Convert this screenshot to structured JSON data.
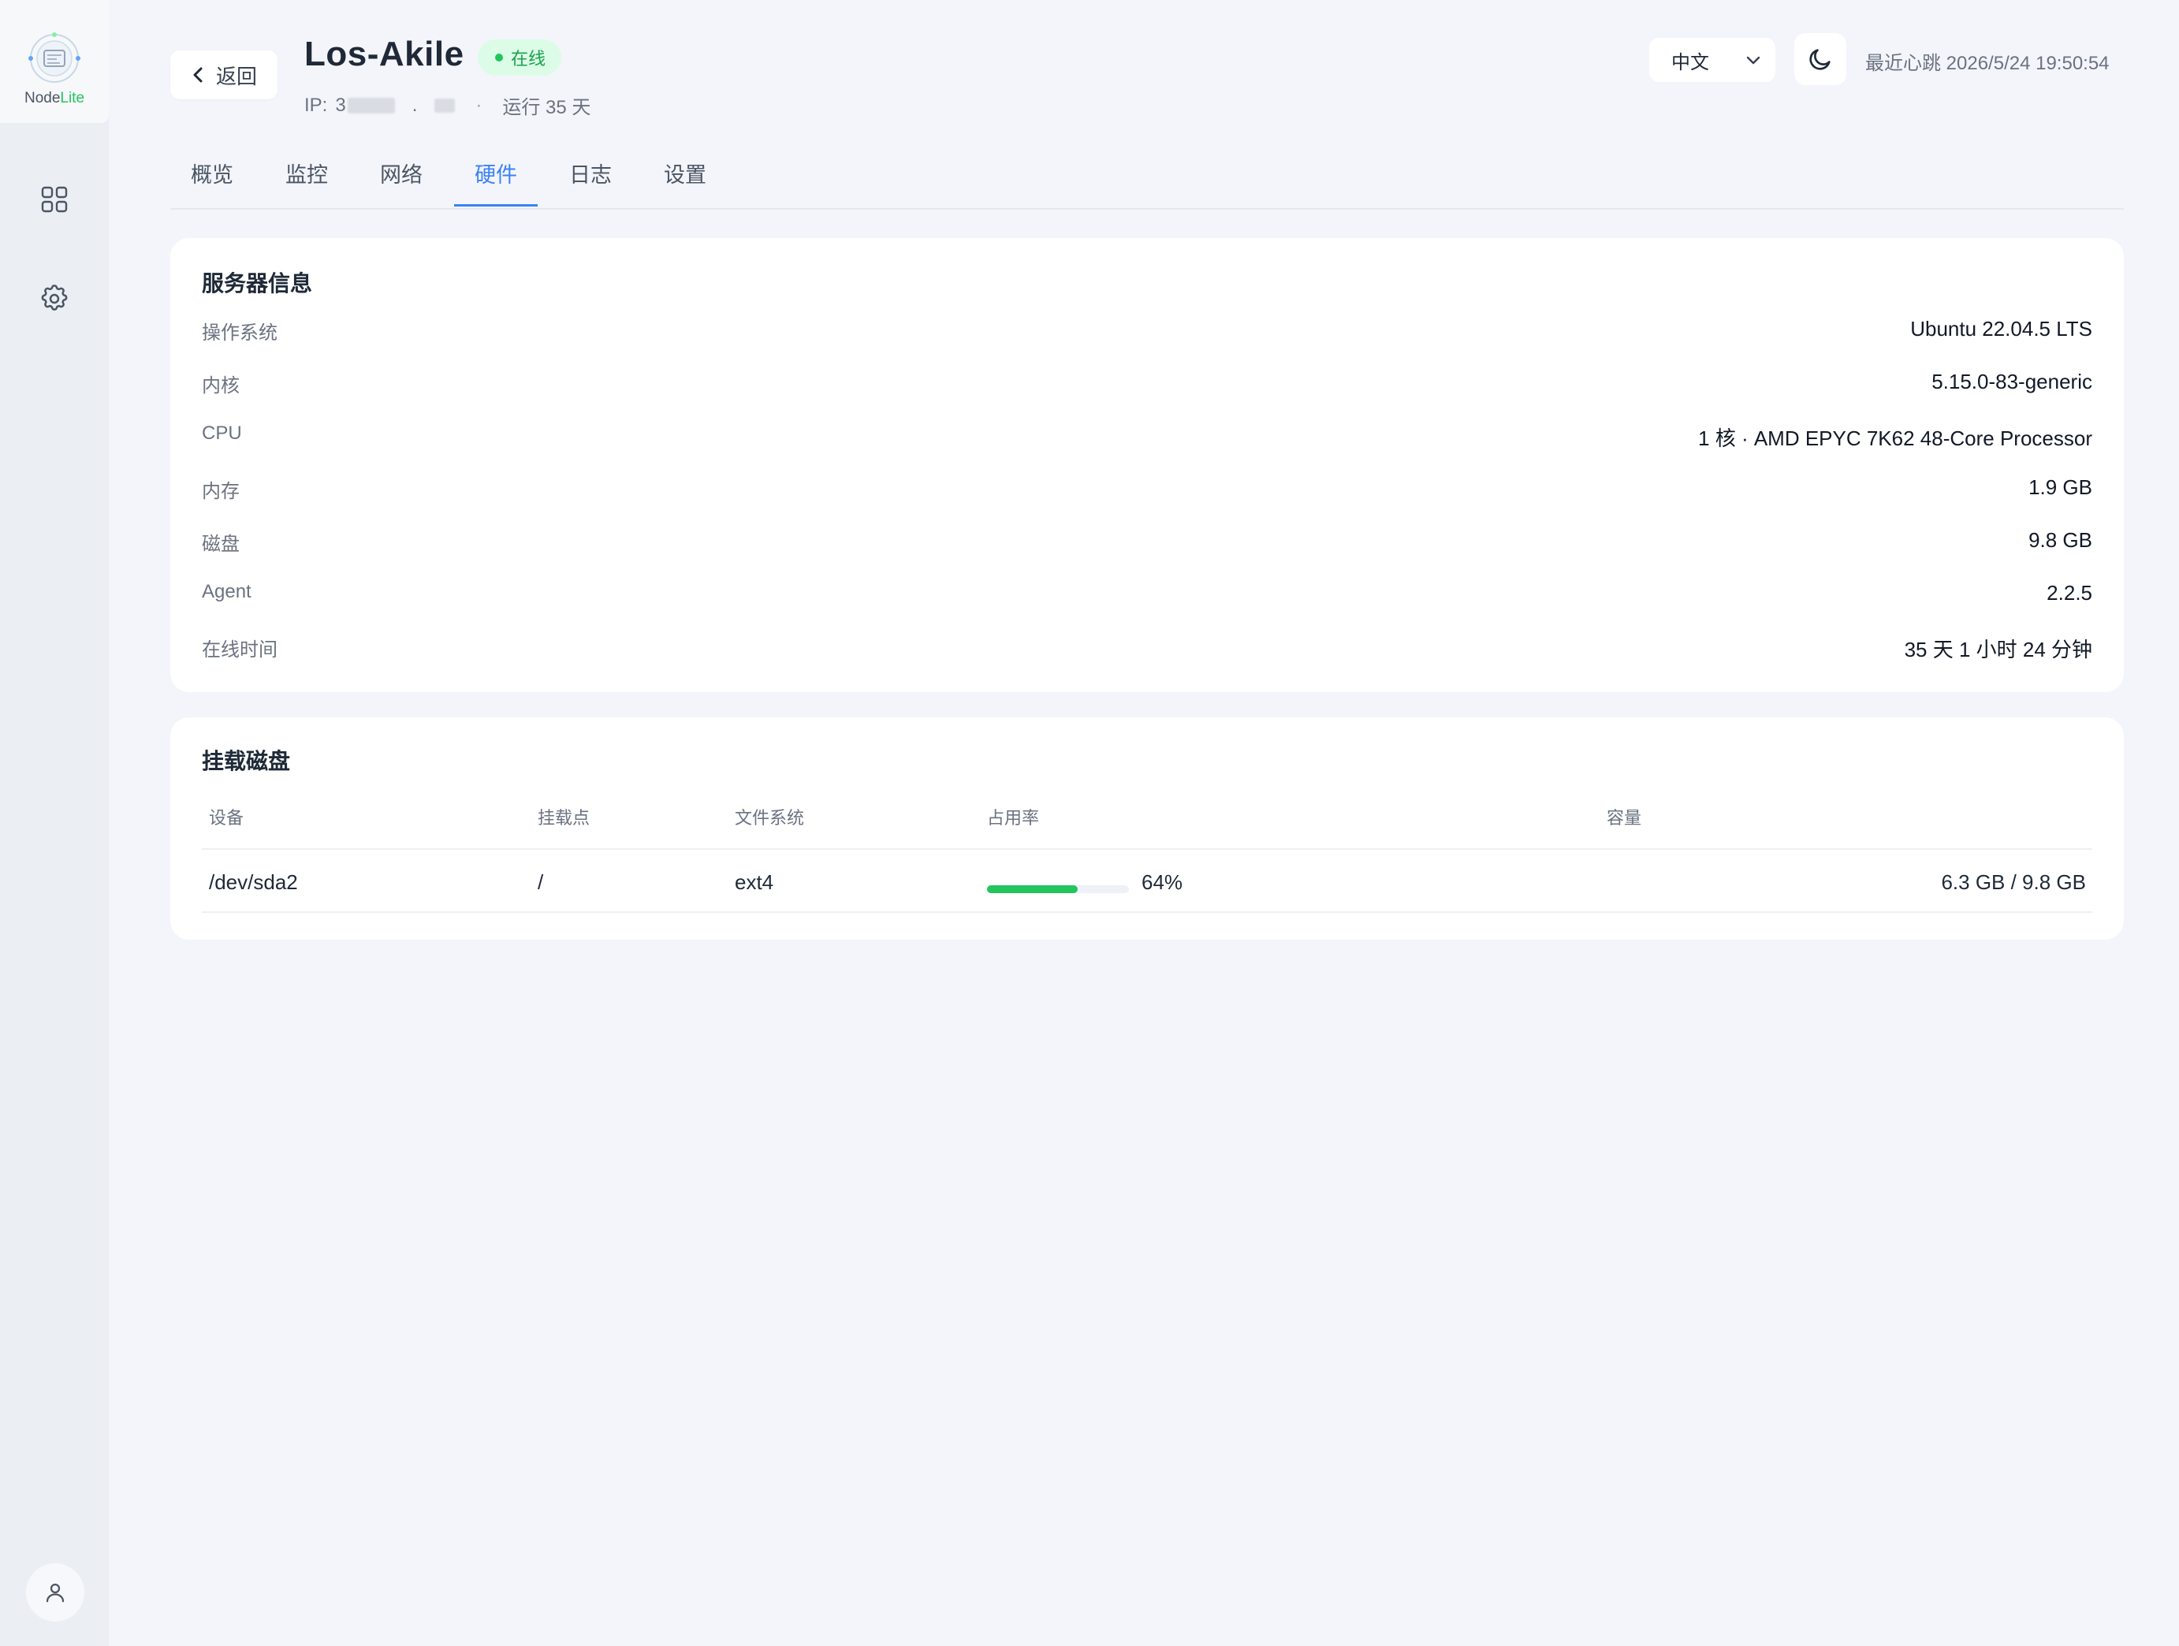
{
  "app": {
    "logo_text_main": "Node",
    "logo_text_accent": "Lite"
  },
  "header": {
    "back_label": "返回",
    "title": "Los-Akile",
    "status": "在线",
    "ip_label": "IP:",
    "ip_partial": "3",
    "ip_dot": ".",
    "uptime_text": "运行 35 天",
    "language": "中文",
    "heartbeat": "最近心跳 2026/5/24 19:50:54"
  },
  "tabs": [
    {
      "label": "概览"
    },
    {
      "label": "监控"
    },
    {
      "label": "网络"
    },
    {
      "label": "硬件",
      "active": true
    },
    {
      "label": "日志"
    },
    {
      "label": "设置"
    }
  ],
  "server_info": {
    "title": "服务器信息",
    "rows": [
      {
        "label": "操作系统",
        "value": "Ubuntu 22.04.5 LTS"
      },
      {
        "label": "内核",
        "value": "5.15.0-83-generic"
      },
      {
        "label": "CPU",
        "value": "1 核 · AMD EPYC 7K62 48-Core Processor"
      },
      {
        "label": "内存",
        "value": "1.9 GB"
      },
      {
        "label": "磁盘",
        "value": "9.8 GB"
      },
      {
        "label": "Agent",
        "value": "2.2.5"
      },
      {
        "label": "在线时间",
        "value": "35 天 1 小时 24 分钟"
      }
    ]
  },
  "disks": {
    "title": "挂载磁盘",
    "columns": [
      "设备",
      "挂载点",
      "文件系统",
      "占用率",
      "容量"
    ],
    "rows": [
      {
        "device": "/dev/sda2",
        "mount": "/",
        "fs": "ext4",
        "usage_percent": 64,
        "usage_text": "64%",
        "capacity": "6.3 GB / 9.8 GB"
      }
    ]
  },
  "colors": {
    "accent": "#3b82f6",
    "online": "#22c55e",
    "background": "#f3f5fa"
  },
  "icons": [
    "logo-icon",
    "dashboard-grid-icon",
    "settings-gear-icon",
    "user-icon",
    "chevron-left-icon",
    "chevron-down-icon",
    "moon-icon"
  ]
}
